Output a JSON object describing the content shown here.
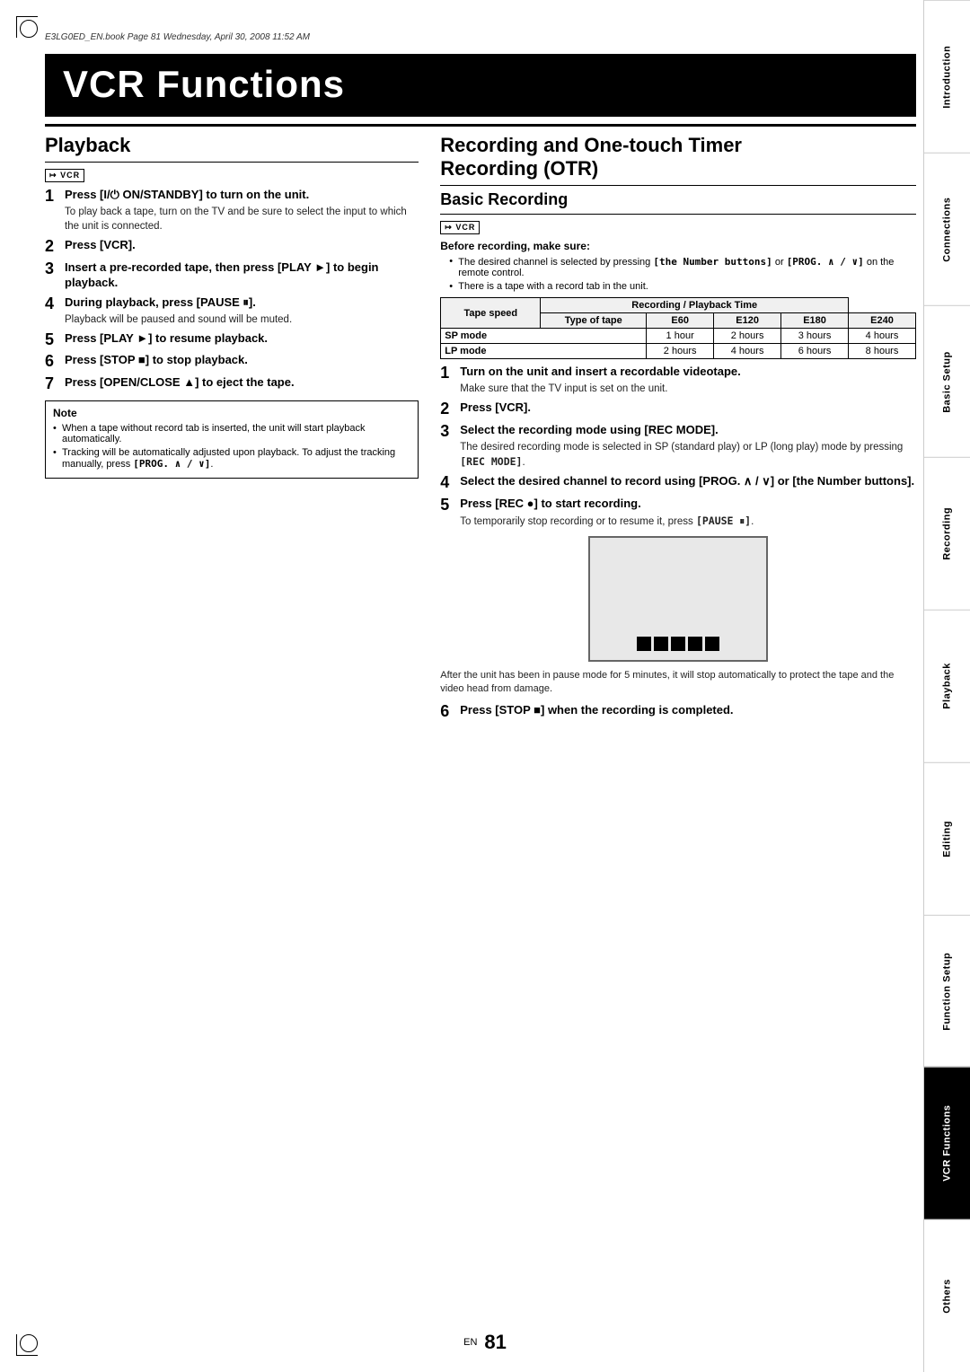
{
  "meta": {
    "file_info": "E3LG0ED_EN.book  Page 81  Wednesday, April 30, 2008  11:52 AM",
    "page_number": "81",
    "en_label": "EN"
  },
  "page_title": "VCR Functions",
  "left_section": {
    "heading": "Playback",
    "vcr_icon": "VCR",
    "steps": [
      {
        "num": "1",
        "title": "Press [I/⏻ ON/STANDBY] to turn on the unit.",
        "body": "To play back a tape, turn on the TV and be sure to select the input to which the unit is connected."
      },
      {
        "num": "2",
        "title": "Press [VCR].",
        "body": ""
      },
      {
        "num": "3",
        "title": "Insert a pre-recorded tape, then press [PLAY ▶] to begin playback.",
        "body": ""
      },
      {
        "num": "4",
        "title": "During playback, press [PAUSE ⏸].",
        "body": "Playback will be paused and sound will be muted."
      },
      {
        "num": "5",
        "title": "Press [PLAY ▶] to resume playback.",
        "body": ""
      },
      {
        "num": "6",
        "title": "Press [STOP ■] to stop playback.",
        "body": ""
      },
      {
        "num": "7",
        "title": "Press [OPEN/CLOSE ▲] to eject the tape.",
        "body": ""
      }
    ],
    "note": {
      "label": "Note",
      "items": [
        "When a tape without record tab is inserted, the unit will start playback automatically.",
        "Tracking will be automatically adjusted upon playback. To adjust the tracking manually, press [PROG. ∧ / ∨]."
      ]
    }
  },
  "right_section": {
    "heading": "Recording and One-touch Timer Recording (OTR)",
    "sub_heading": "Basic Recording",
    "vcr_icon": "VCR",
    "before_recording": {
      "label": "Before recording, make sure:",
      "items": [
        "The desired channel is selected by pressing [the Number buttons] or [PROG. ∧ / ∨] on the remote control.",
        "There is a tape with a record tab in the unit."
      ]
    },
    "table": {
      "headers": [
        "Tape speed",
        "Recording / Playback Time"
      ],
      "sub_headers": [
        "Type of tape",
        "E60",
        "E120",
        "E180",
        "E240"
      ],
      "rows": [
        {
          "label": "SP mode",
          "values": [
            "1 hour",
            "2 hours",
            "3 hours",
            "4 hours"
          ]
        },
        {
          "label": "LP mode",
          "values": [
            "2 hours",
            "4 hours",
            "6 hours",
            "8 hours"
          ]
        }
      ]
    },
    "steps": [
      {
        "num": "1",
        "title": "Turn on the unit and insert a recordable videotape.",
        "body": "Make sure that the TV input is set on the unit."
      },
      {
        "num": "2",
        "title": "Press [VCR].",
        "body": ""
      },
      {
        "num": "3",
        "title": "Select the recording mode using [REC MODE].",
        "body": "The desired recording mode is selected in SP (standard play) or LP (long play) mode by pressing [REC MODE]."
      },
      {
        "num": "4",
        "title": "Select the desired channel to record using [PROG. ∧ / ∨] or [the Number buttons].",
        "body": ""
      },
      {
        "num": "5",
        "title": "Press [REC ●] to start recording.",
        "body": "To temporarily stop recording or to resume it, press [PAUSE ⏸]."
      },
      {
        "num": "6",
        "title": "Press [STOP ■] when the recording is completed.",
        "body": ""
      }
    ],
    "screen_caption": "After the unit has been in pause mode for 5 minutes, it will stop automatically to protect the tape and the video head from damage.",
    "screen_squares_count": 5
  },
  "sidebar": {
    "tabs": [
      {
        "label": "Introduction",
        "active": false
      },
      {
        "label": "Connections",
        "active": false
      },
      {
        "label": "Basic Setup",
        "active": false
      },
      {
        "label": "Recording",
        "active": false
      },
      {
        "label": "Playback",
        "active": false
      },
      {
        "label": "Editing",
        "active": false
      },
      {
        "label": "Function Setup",
        "active": false
      },
      {
        "label": "VCR Functions",
        "active": true
      },
      {
        "label": "Others",
        "active": false
      }
    ]
  }
}
